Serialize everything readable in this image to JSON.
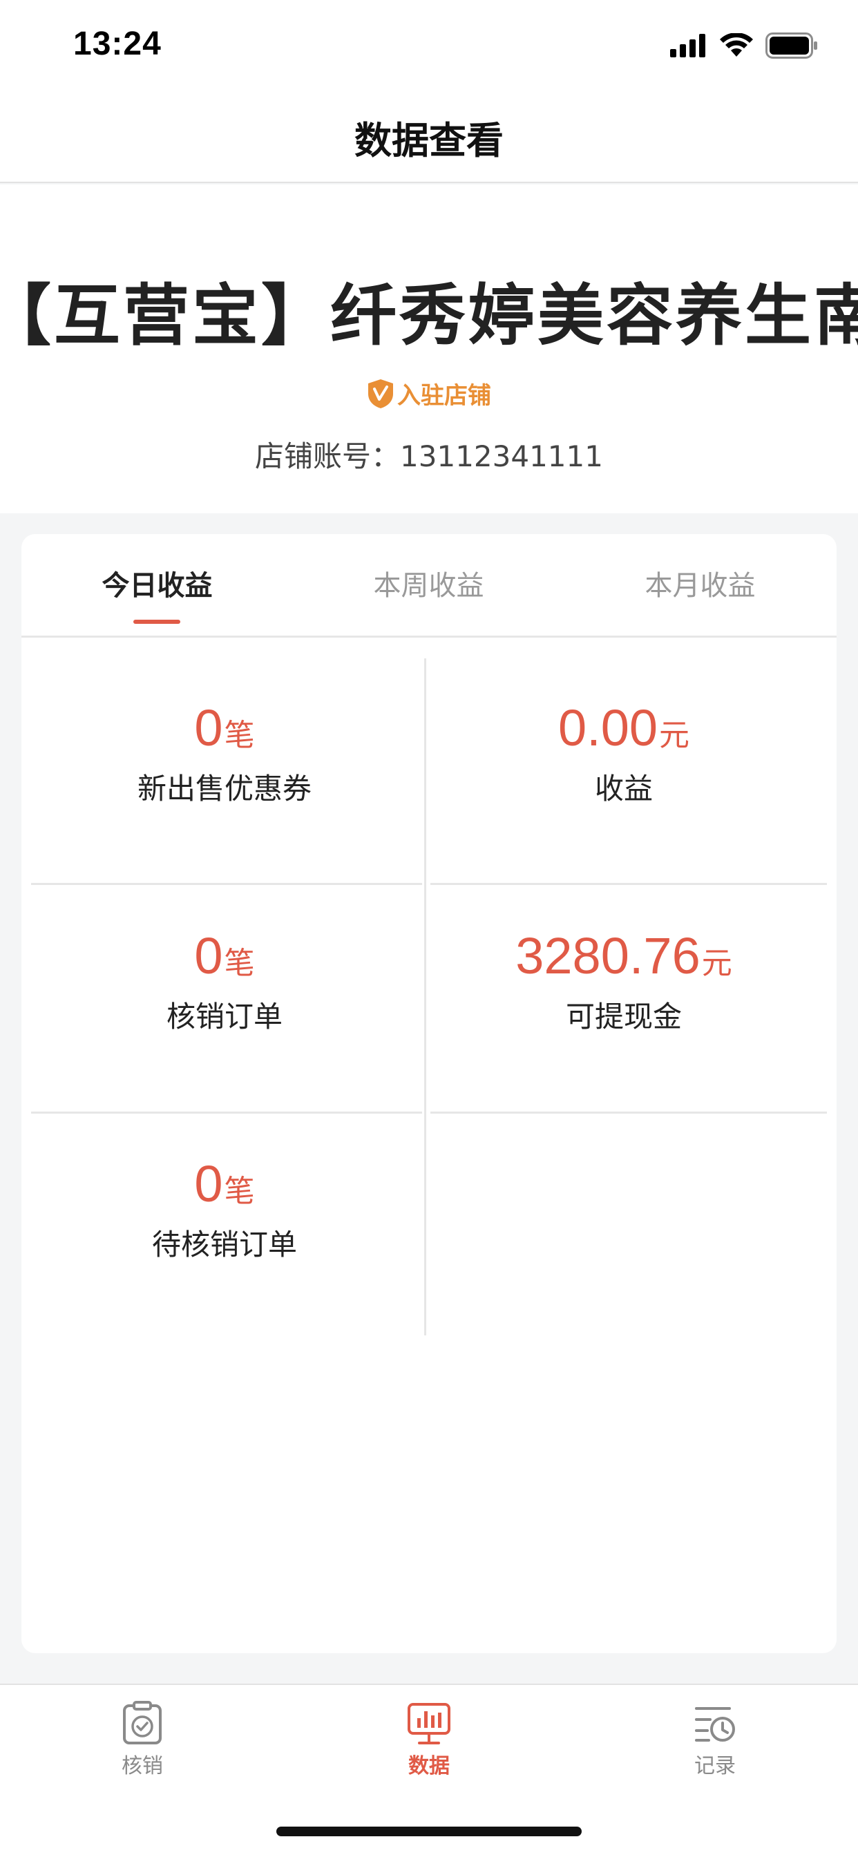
{
  "status_bar": {
    "time": "13:24"
  },
  "nav": {
    "title": "数据查看"
  },
  "store": {
    "name": "【互营宝】纤秀婷美容养生南坪店",
    "badge": "入驻店铺",
    "account_label": "店铺账号：",
    "account_number": "13112341111"
  },
  "tabs": [
    {
      "label": "今日收益",
      "active": true
    },
    {
      "label": "本周收益",
      "active": false
    },
    {
      "label": "本月收益",
      "active": false
    }
  ],
  "stats": [
    {
      "value": "0",
      "unit": "笔",
      "label": "新出售优惠券"
    },
    {
      "value": "0.00",
      "unit": "元",
      "label": "收益"
    },
    {
      "value": "0",
      "unit": "笔",
      "label": "核销订单"
    },
    {
      "value": "3280.76",
      "unit": "元",
      "label": "可提现金"
    },
    {
      "value": "0",
      "unit": "笔",
      "label": "待核销订单"
    }
  ],
  "tabbar": [
    {
      "label": "核销",
      "icon": "clipboard-check-icon",
      "active": false
    },
    {
      "label": "数据",
      "icon": "chart-monitor-icon",
      "active": true
    },
    {
      "label": "记录",
      "icon": "history-list-icon",
      "active": false
    }
  ],
  "colors": {
    "accent": "#e05a46",
    "badge": "#e98f35",
    "inactive": "#8a8a8a"
  }
}
